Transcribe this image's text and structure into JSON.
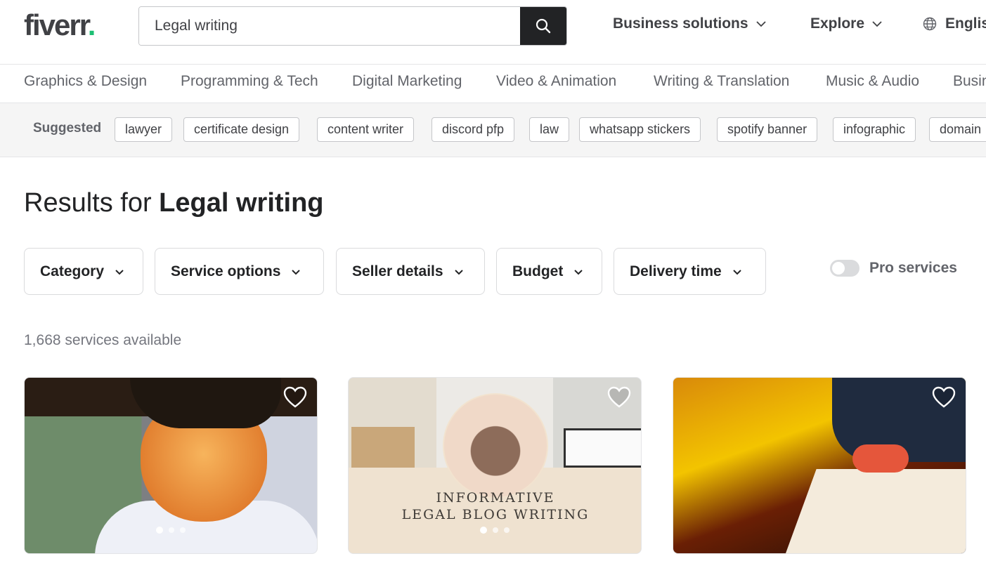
{
  "header": {
    "logo": "fiverr",
    "logo_dot": ".",
    "search_value": "Legal writing",
    "nav": {
      "business": "Business solutions",
      "explore": "Explore",
      "language": "English"
    }
  },
  "categories": [
    "Graphics & Design",
    "Programming & Tech",
    "Digital Marketing",
    "Video & Animation",
    "Writing & Translation",
    "Music & Audio",
    "Business"
  ],
  "suggested": {
    "label": "Suggested",
    "tags": [
      "lawyer",
      "certificate design",
      "content writer",
      "discord pfp",
      "law",
      "whatsapp stickers",
      "spotify banner",
      "infographic",
      "domain"
    ]
  },
  "results": {
    "prefix": "Results for ",
    "query": "Legal writing",
    "count": "1,668 services available"
  },
  "filters": [
    "Category",
    "Service options",
    "Seller details",
    "Budget",
    "Delivery time"
  ],
  "pro_label": "Pro services",
  "cards": {
    "card2_line1": "INFORMATIVE",
    "card2_line2": "LEGAL BLOG WRITING"
  },
  "colors": {
    "brand_green": "#1dbf73",
    "dark": "#222325",
    "muted": "#62646a"
  }
}
